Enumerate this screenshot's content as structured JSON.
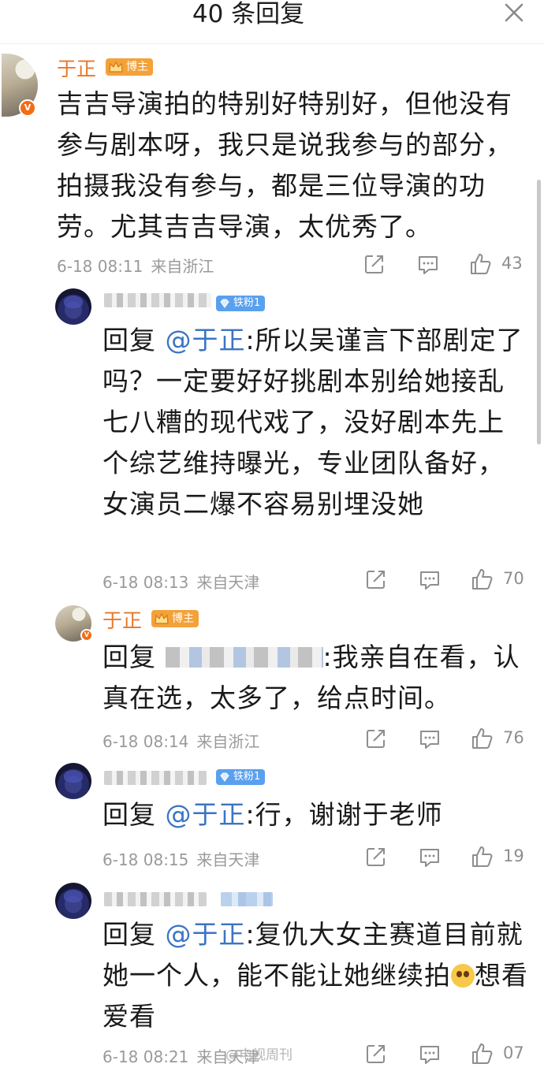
{
  "header": {
    "title": "40 条回复"
  },
  "comments": [
    {
      "username": "于正",
      "badge": "博主",
      "text": "吉吉导演拍的特别好特别好，但他没有参与剧本呀，我只是说我参与的部分，拍摄我没有参与，都是三位导演的功劳。尤其吉吉导演，太优秀了。",
      "time": "6-18 08:11",
      "source": "来自浙江",
      "likes": "43"
    },
    {
      "username": "",
      "badge": "铁粉1",
      "reply_prefix": "回复",
      "mention": "@于正",
      "text": ":所以吴谨言下部剧定了吗？一定要好好挑剧本别给她接乱七八糟的现代戏了，没好剧本先上个综艺维持曝光，专业团队备好，女演员二爆不容易别埋没她",
      "time": "6-18 08:13",
      "source": "来自天津",
      "likes": "70"
    },
    {
      "username": "于正",
      "badge": "博主",
      "reply_prefix": "回复",
      "text": ":我亲自在看，认真在选，太多了，给点时间。",
      "time": "6-18 08:14",
      "source": "来自浙江",
      "likes": "76"
    },
    {
      "username": "",
      "badge": "铁粉1",
      "reply_prefix": "回复",
      "mention": "@于正",
      "text": ":行，谢谢于老师",
      "time": "6-18 08:15",
      "source": "来自天津",
      "likes": "19"
    },
    {
      "username": "",
      "reply_prefix": "回复",
      "mention": "@于正",
      "text": ":复仇大女主赛道目前就她一个人，能不能让她继续拍",
      "text_after_emoji": "想看爱看",
      "time": "6-18 08:21",
      "source": "来自天津",
      "likes": "07"
    }
  ],
  "watermark": "@电视周刊",
  "colors": {
    "username": "#e8772a",
    "mention": "#3b74c4",
    "bozhu_badge": "#f3a23a",
    "tiefen_badge": "#5aa0ee",
    "meta": "#9a9a9a"
  },
  "icons": [
    "close-icon",
    "share-icon",
    "comment-icon",
    "like-icon",
    "crown-icon",
    "diamond-icon",
    "verified-icon",
    "emoji-icon"
  ]
}
